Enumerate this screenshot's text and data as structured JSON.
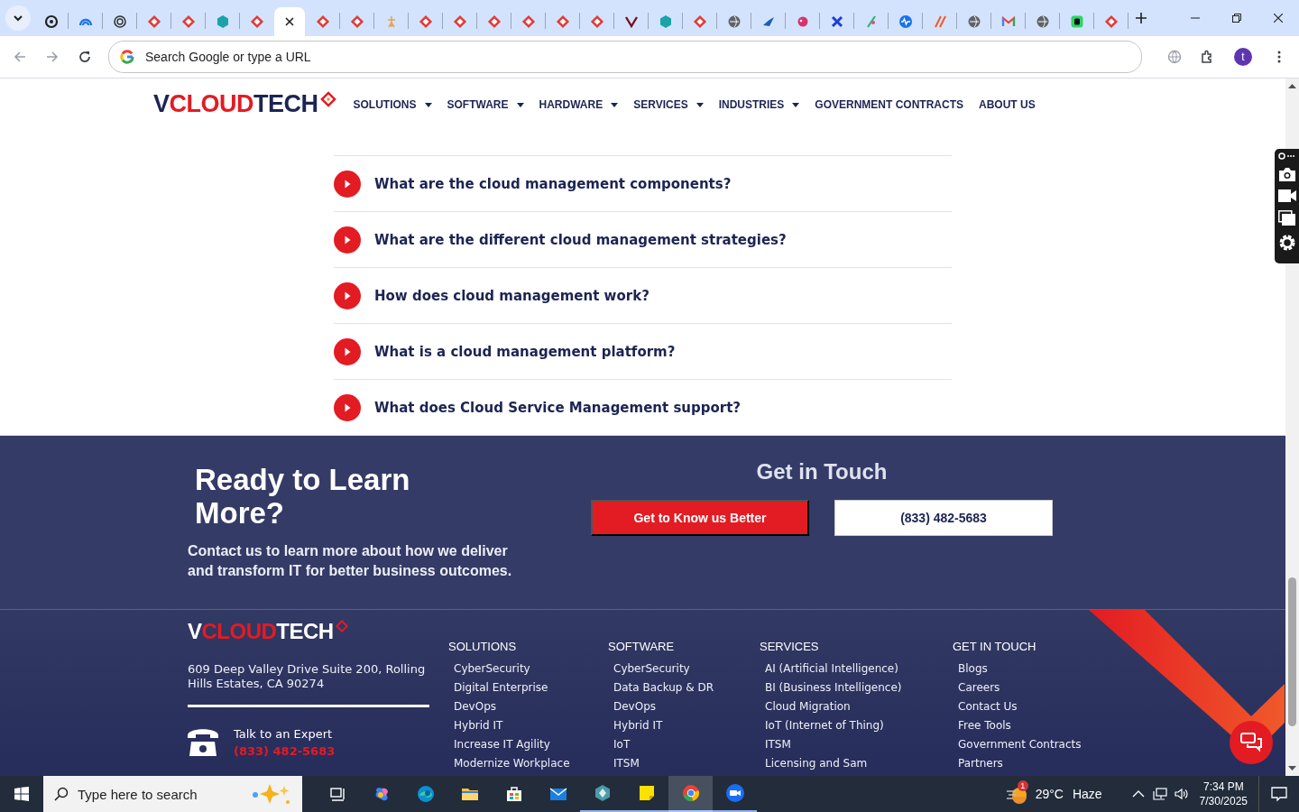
{
  "browser": {
    "tabs": [
      {
        "kind": "ring",
        "selected": false
      },
      {
        "kind": "arc",
        "selected": false
      },
      {
        "kind": "swirl",
        "selected": false
      },
      {
        "kind": "diamond",
        "selected": false
      },
      {
        "kind": "diamond",
        "selected": false
      },
      {
        "kind": "hexagon",
        "selected": false
      },
      {
        "kind": "diamond",
        "selected": false
      },
      {
        "selected": true
      },
      {
        "kind": "diamond",
        "selected": false
      },
      {
        "kind": "diamond",
        "selected": false
      },
      {
        "kind": "figure",
        "selected": false
      },
      {
        "kind": "diamond",
        "selected": false
      },
      {
        "kind": "diamond",
        "selected": false
      },
      {
        "kind": "diamond",
        "selected": false
      },
      {
        "kind": "diamond",
        "selected": false
      },
      {
        "kind": "diamond",
        "selected": false
      },
      {
        "kind": "diamond",
        "selected": false
      },
      {
        "kind": "chevron",
        "selected": false
      },
      {
        "kind": "hexagon",
        "selected": false
      },
      {
        "kind": "diamond",
        "selected": false
      },
      {
        "kind": "globe",
        "selected": false
      },
      {
        "kind": "swoosh",
        "selected": false
      },
      {
        "kind": "ball",
        "selected": false
      },
      {
        "kind": "cross",
        "selected": false
      },
      {
        "kind": "spark",
        "selected": false
      },
      {
        "kind": "pulse",
        "selected": false
      },
      {
        "kind": "slash",
        "selected": false
      },
      {
        "kind": "globe",
        "selected": false
      },
      {
        "kind": "mail",
        "selected": false
      },
      {
        "kind": "globe",
        "selected": false
      },
      {
        "kind": "square",
        "selected": false
      },
      {
        "kind": "diamond",
        "selected": false
      }
    ],
    "address_bar": {
      "placeholder": "Search Google or type a URL"
    },
    "profile": {
      "initial": "t"
    }
  },
  "site": {
    "logo": [
      {
        "text": "V",
        "color": "#1c2453"
      },
      {
        "text": "CLOUD",
        "color": "#e31b23"
      },
      {
        "text": " TECH",
        "color": "#1c2453"
      }
    ],
    "nav": [
      {
        "label": "SOLUTIONS",
        "dropdown": true
      },
      {
        "label": "SOFTWARE",
        "dropdown": true
      },
      {
        "label": "HARDWARE",
        "dropdown": true
      },
      {
        "label": "SERVICES",
        "dropdown": true
      },
      {
        "label": "INDUSTRIES",
        "dropdown": true
      },
      {
        "label": "GOVERNMENT CONTRACTS",
        "dropdown": false
      },
      {
        "label": "ABOUT US",
        "dropdown": false
      }
    ]
  },
  "faq": [
    {
      "question": "What are the cloud management components?"
    },
    {
      "question": "What are the different cloud management strategies?"
    },
    {
      "question": "How does cloud management work?"
    },
    {
      "question": "What is a cloud management platform?"
    },
    {
      "question": "What does Cloud Service Management support?"
    }
  ],
  "cta": {
    "heading": "Ready to Learn More?",
    "text": "Contact us to learn more about how we deliver and transform IT for better business outcomes.",
    "contact_heading": "Get in Touch",
    "buttons": [
      {
        "label": "Get to Know us Better",
        "kind": "primary"
      },
      {
        "label": "(833) 482-5683",
        "kind": "outline"
      }
    ]
  },
  "footer": {
    "logo": [
      {
        "text": "V",
        "color": "#ffffff"
      },
      {
        "text": "CLOUD",
        "color": "#e31b23"
      },
      {
        "text": " TECH",
        "color": "#ffffff"
      }
    ],
    "address": "609 Deep Valley Drive Suite 200, Rolling Hills Estates, CA 90274",
    "contact_label": "Talk to an Expert",
    "contact_phone": "(833) 482-5683",
    "columns": [
      {
        "heading": "SOLUTIONS",
        "links": [
          "CyberSecurity",
          "Digital Enterprise",
          "DevOps",
          "Hybrid IT",
          "Increase IT Agility",
          "Modernize Workplace"
        ]
      },
      {
        "heading": "SOFTWARE",
        "links": [
          "CyberSecurity",
          "Data Backup & DR",
          "DevOps",
          "Hybrid IT",
          "IoT",
          "ITSM"
        ]
      },
      {
        "heading": "SERVICES",
        "links": [
          "AI (Artificial Intelligence)",
          "BI (Business Intelligence)",
          "Cloud Migration",
          "IoT (Internet of Thing)",
          "ITSM",
          "Licensing and Sam"
        ]
      },
      {
        "heading": "GET IN TOUCH",
        "links": [
          "Blogs",
          "Careers",
          "Contact Us",
          "Free Tools",
          "Government Contracts",
          "Partners"
        ]
      }
    ]
  },
  "taskbar": {
    "search_placeholder": "Type here to search",
    "apps": [
      {
        "kind": "task-view",
        "open": false,
        "selected": false
      },
      {
        "kind": "copilot",
        "open": false,
        "selected": false
      },
      {
        "kind": "edge",
        "open": false,
        "selected": false
      },
      {
        "kind": "folder",
        "open": false,
        "selected": false
      },
      {
        "kind": "store",
        "open": false,
        "selected": false
      },
      {
        "kind": "mail",
        "open": false,
        "selected": false
      },
      {
        "kind": "hexagon",
        "open": true,
        "selected": false
      },
      {
        "kind": "note",
        "open": true,
        "selected": false
      },
      {
        "kind": "chrome",
        "open": true,
        "selected": true
      },
      {
        "kind": "video",
        "open": true,
        "selected": false
      }
    ],
    "weather": {
      "badge": "1",
      "temperature": "29°C",
      "condition": "Haze"
    },
    "time": "7:34 PM",
    "date": "7/30/2025"
  }
}
